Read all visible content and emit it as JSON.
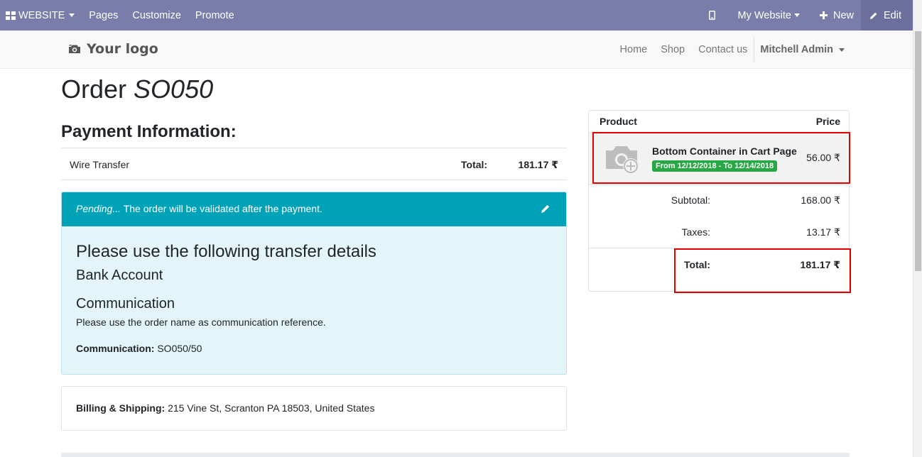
{
  "adminbar": {
    "website_label": "WEBSITE",
    "pages_label": "Pages",
    "customize_label": "Customize",
    "promote_label": "Promote",
    "mywebsite_label": "My Website",
    "new_label": "New",
    "edit_label": "Edit"
  },
  "header": {
    "logo_text": "Your logo",
    "nav": [
      "Home",
      "Shop",
      "Contact us"
    ],
    "user": "Mitchell Admin"
  },
  "order": {
    "title_prefix": "Order",
    "title_ref": "SO050"
  },
  "payment": {
    "heading": "Payment Information:",
    "method": "Wire Transfer",
    "total_label": "Total:",
    "total_value": "181.17 ₹"
  },
  "pending": {
    "status": "Pending...",
    "message": " The order will be validated after the payment.",
    "transfer_heading": "Please use the following transfer details",
    "bank_heading": "Bank Account",
    "comm_heading": "Communication",
    "comm_text": "Please use the order name as communication reference.",
    "comm_label": "Communication:",
    "comm_value": " SO050/50"
  },
  "billing": {
    "label": "Billing & Shipping:",
    "address": " 215 Vine St, Scranton PA 18503, United States"
  },
  "cart": {
    "product_header": "Product",
    "price_header": "Price",
    "line": {
      "name": "Bottom Container in Cart Page",
      "badge": "From 12/12/2018 - To 12/14/2018",
      "price": "56.00 ₹"
    },
    "subtotal_label": "Subtotal:",
    "subtotal_value": "168.00 ₹",
    "taxes_label": "Taxes:",
    "taxes_value": "13.17 ₹",
    "total_label": "Total:",
    "total_value": "181.17 ₹"
  },
  "colors": {
    "adminbar": "#7a7ca9",
    "pending_header": "#00a2b8",
    "pending_body": "#e3f5f8",
    "badge": "#28a745",
    "highlight": "#e00000"
  },
  "icons": [
    "grid-icon",
    "mobile-icon",
    "plus-icon",
    "pencil-icon",
    "camera-icon",
    "image-placeholder-icon"
  ]
}
